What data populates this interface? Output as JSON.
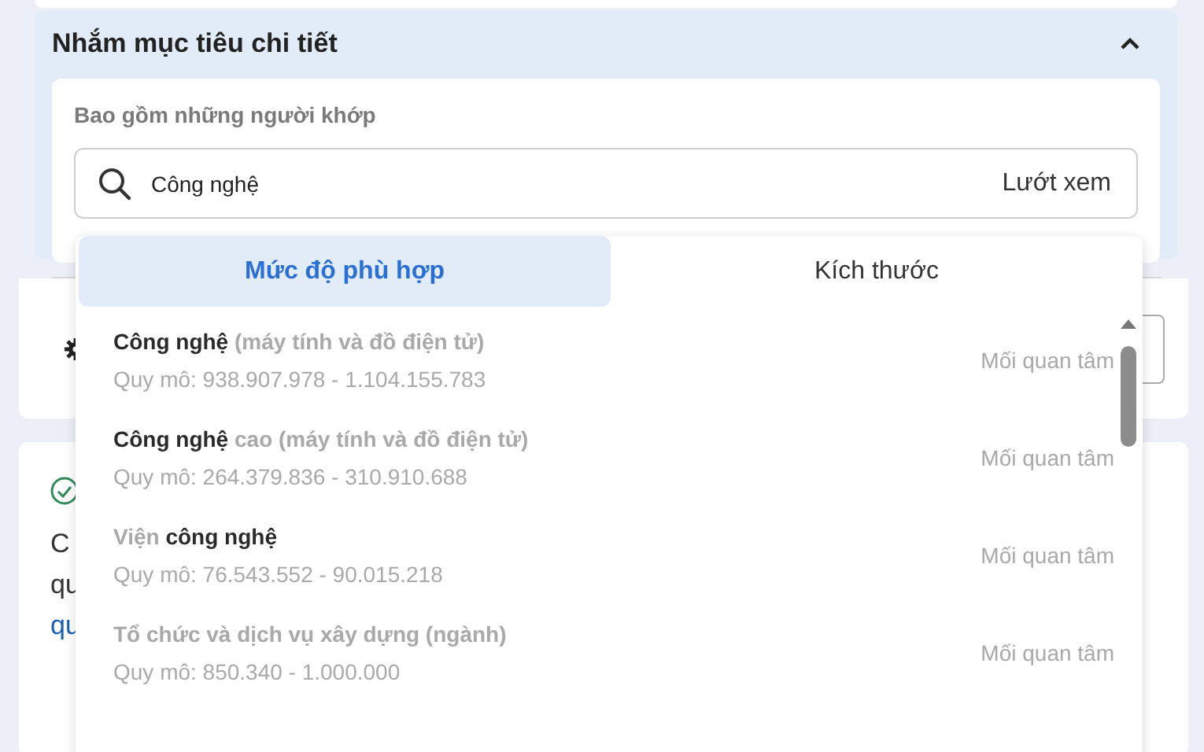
{
  "panel": {
    "title": "Nhắm mục tiêu chi tiết",
    "expanded": true,
    "field_label": "Bao gồm những người khớp",
    "search": {
      "value": "Công nghệ",
      "browse": "Lướt xem"
    }
  },
  "partial_card": {
    "lines": [
      "C",
      "qu",
      "qu"
    ]
  },
  "dropdown": {
    "tabs": [
      {
        "label": "Mức độ phù hợp",
        "selected": true
      },
      {
        "label": "Kích thước",
        "selected": false
      }
    ],
    "options": [
      {
        "title": "**Công nghệ** (máy tính và đồ điện tử)",
        "scale": "Quy mô: 938.907.978 - 1.104.155.783",
        "category": "Mối quan tâm"
      },
      {
        "title": "**Công nghệ** cao (máy tính và đồ điện tử)",
        "scale": "Quy mô: 264.379.836 - 310.910.688",
        "category": "Mối quan tâm"
      },
      {
        "title": "Viện **công nghệ**",
        "scale": "Quy mô: 76.543.552 - 90.015.218",
        "category": "Mối quan tâm"
      },
      {
        "title": "Tổ chức và dịch vụ xây dựng (ngành)",
        "scale": "Quy mô: 850.340 - 1.000.000",
        "category": "Mối quan tâm"
      }
    ]
  }
}
